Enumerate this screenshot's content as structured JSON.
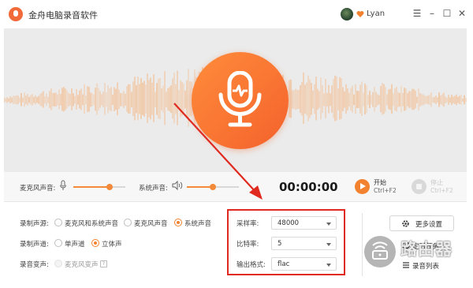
{
  "app": {
    "title": "金舟电脑录音软件",
    "user_name": "Lyan",
    "window_controls": [
      "menu-icon",
      "minimize-icon",
      "maximize-icon",
      "close-icon"
    ]
  },
  "controls": {
    "mic_volume_label": "麦克风声音:",
    "mic_volume_level": 0.7,
    "system_volume_label": "系统声音:",
    "system_volume_level": 0.5,
    "timer": "00:00:00",
    "start_label": "开始",
    "start_shortcut": "Ctrl+F2",
    "stop_label": "停止",
    "stop_shortcut": "Ctrl+F2"
  },
  "settings": {
    "source": {
      "label": "录制声源:",
      "options": [
        "麦克风和系统声音",
        "麦克风声音",
        "系统声音"
      ],
      "selected": 2
    },
    "channel": {
      "label": "录制声道:",
      "options": [
        "单声道",
        "立体声"
      ],
      "selected": 1
    },
    "voice_change": {
      "label": "录音变声:",
      "option": "麦克风变声",
      "enabled": false
    },
    "sample_rate": {
      "label": "采样率:",
      "value": "48000"
    },
    "bit_rate": {
      "label": "比特率:",
      "value": "5"
    },
    "output_format": {
      "label": "输出格式:",
      "value": "flac"
    }
  },
  "side": {
    "more_settings": "更多设置",
    "scheduled": "定时任务",
    "record_list": "录音列表"
  },
  "watermark": {
    "text": "路由器"
  },
  "colors": {
    "accent": "#f2822f",
    "highlight_box": "#e02a20",
    "waveform": "#f6b27a"
  }
}
